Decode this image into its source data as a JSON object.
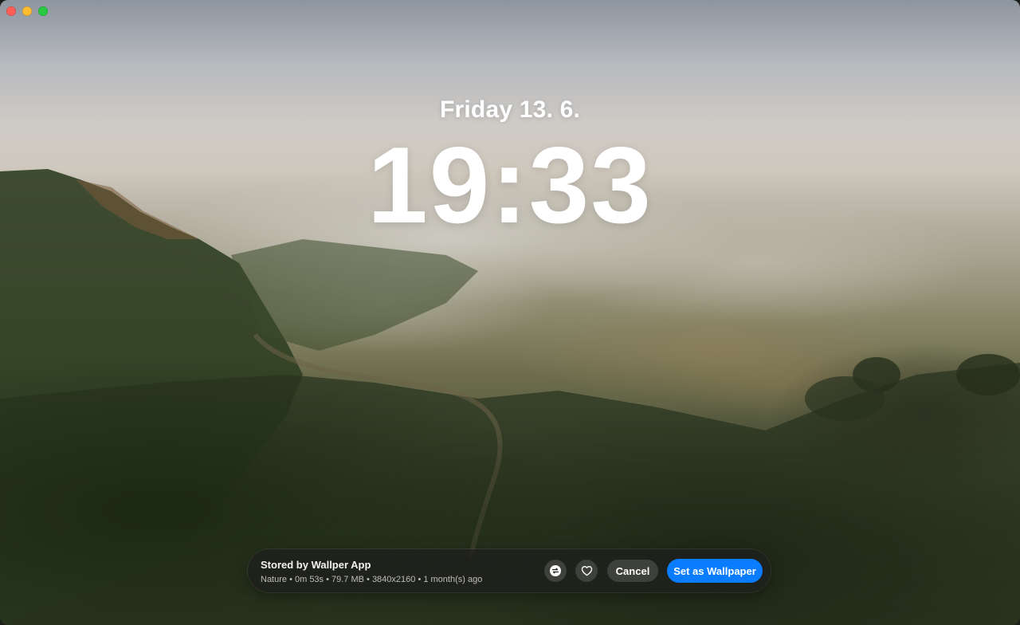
{
  "window": {
    "controls": [
      "close",
      "minimize",
      "zoom"
    ]
  },
  "lockscreen": {
    "date": "Friday 13. 6.",
    "time": "19:33"
  },
  "bar": {
    "title": "Stored by Wallper App",
    "meta": "Nature • 0m 53s • 79.7 MB • 3840x2160 • 1 month(s) ago",
    "swap_icon": "arrow-swap-icon",
    "favorite_icon": "heart-icon",
    "cancel_label": "Cancel",
    "set_label": "Set as Wallpaper"
  },
  "colors": {
    "accent": "#0a7cff",
    "bar_bg": "#1e201c"
  }
}
